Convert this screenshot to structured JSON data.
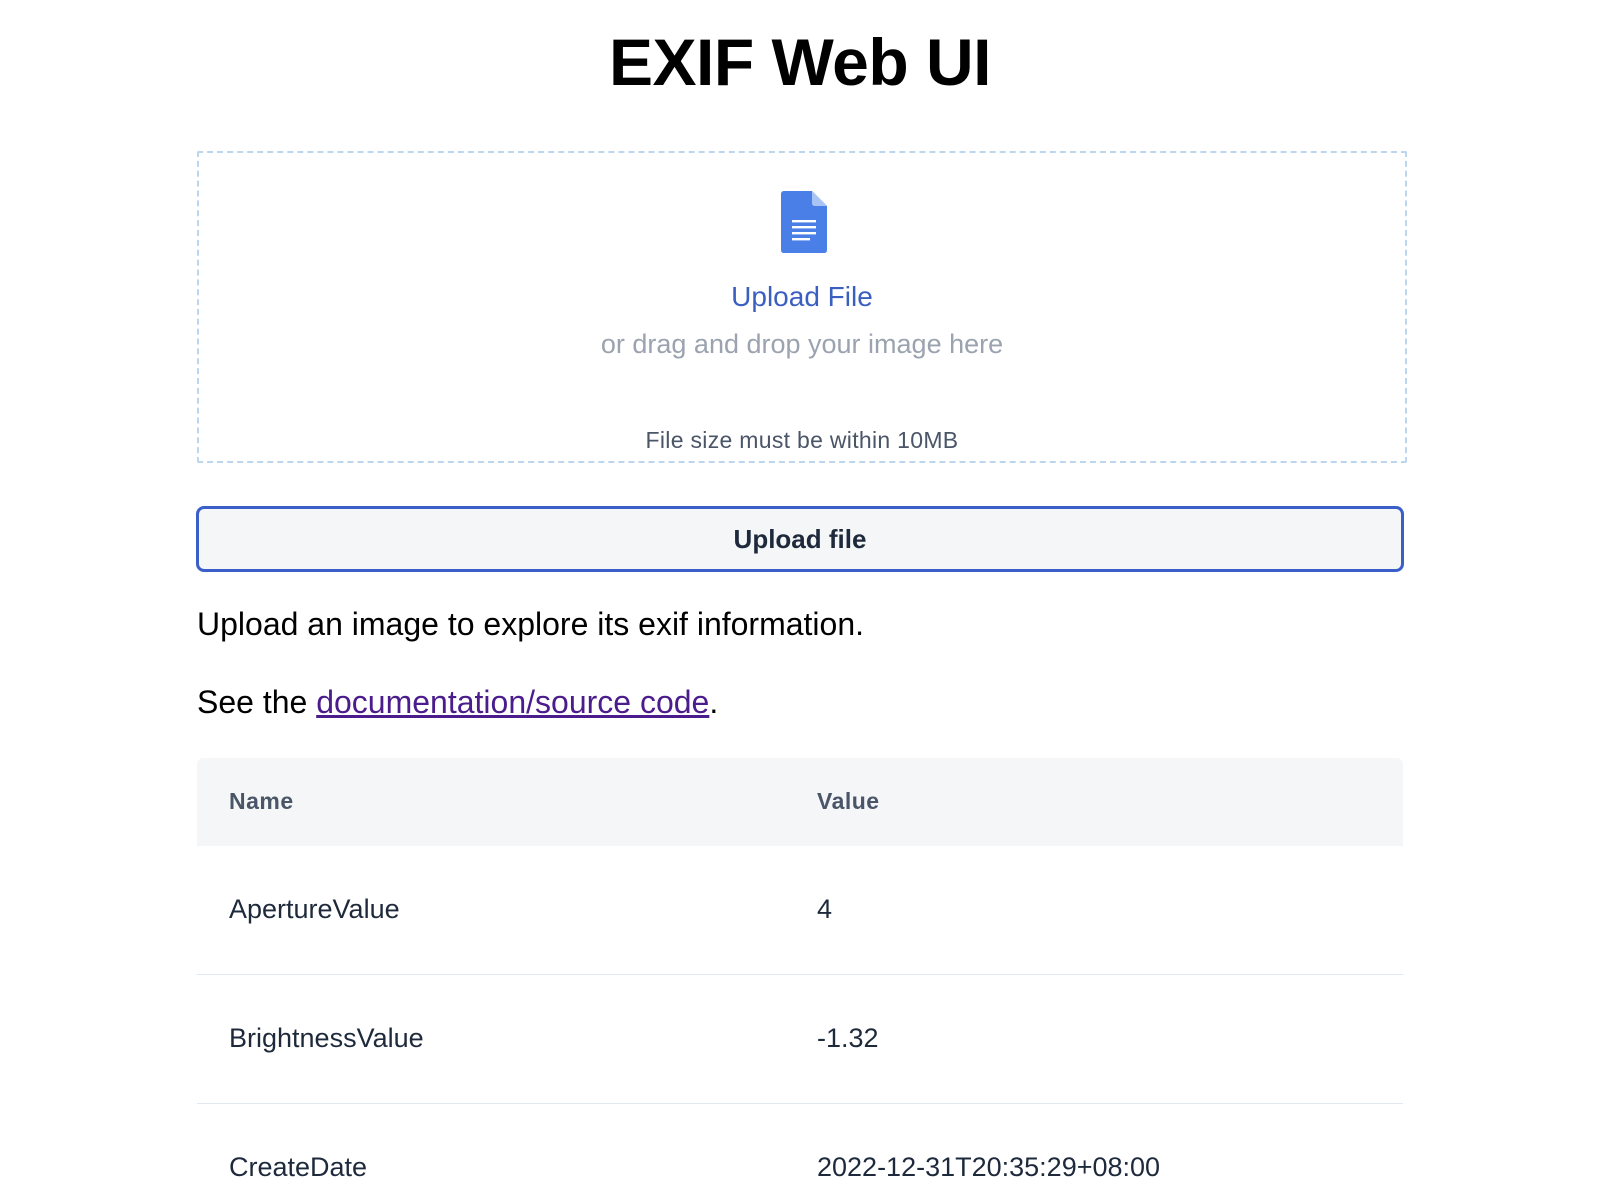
{
  "page": {
    "title": "EXIF Web UI"
  },
  "dropzone": {
    "icon": "file-document-icon",
    "upload_label": "Upload File",
    "drag_hint": "or drag and drop your image here",
    "size_note": "File size must be within 10MB"
  },
  "upload_button": {
    "label": "Upload file"
  },
  "intro": {
    "text": "Upload an image to explore its exif information."
  },
  "docs": {
    "prefix": "See the ",
    "link_text": "documentation/source code",
    "suffix": "."
  },
  "table": {
    "headers": {
      "name": "Name",
      "value": "Value"
    },
    "rows": [
      {
        "name": "ApertureValue",
        "value": "4"
      },
      {
        "name": "BrightnessValue",
        "value": "-1.32"
      },
      {
        "name": "CreateDate",
        "value": "2022-12-31T20:35:29+08:00"
      }
    ]
  },
  "colors": {
    "accent": "#3a5fc8",
    "link_visited": "#4b1c8c",
    "icon_blue": "#4a7fe8",
    "dropzone_border": "#bdd6ef",
    "table_header_bg": "#f4f6f8"
  }
}
